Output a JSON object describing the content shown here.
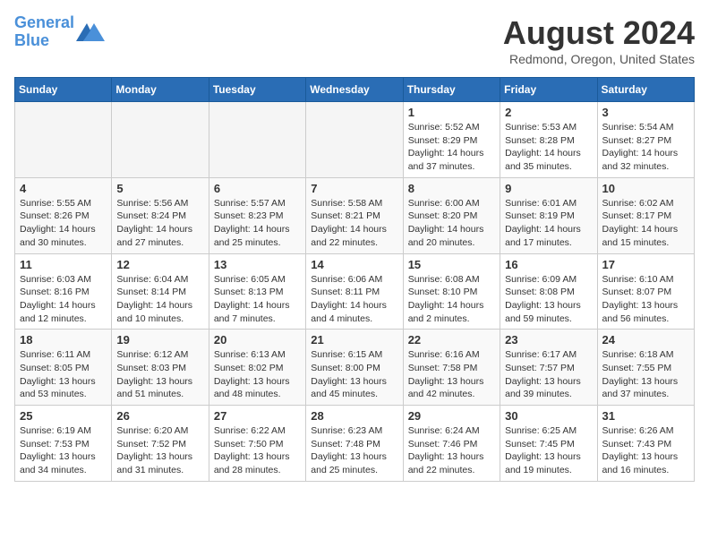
{
  "header": {
    "logo_line1": "General",
    "logo_line2": "Blue",
    "month": "August 2024",
    "location": "Redmond, Oregon, United States"
  },
  "weekdays": [
    "Sunday",
    "Monday",
    "Tuesday",
    "Wednesday",
    "Thursday",
    "Friday",
    "Saturday"
  ],
  "weeks": [
    [
      {
        "day": "",
        "info": ""
      },
      {
        "day": "",
        "info": ""
      },
      {
        "day": "",
        "info": ""
      },
      {
        "day": "",
        "info": ""
      },
      {
        "day": "1",
        "info": "Sunrise: 5:52 AM\nSunset: 8:29 PM\nDaylight: 14 hours\nand 37 minutes."
      },
      {
        "day": "2",
        "info": "Sunrise: 5:53 AM\nSunset: 8:28 PM\nDaylight: 14 hours\nand 35 minutes."
      },
      {
        "day": "3",
        "info": "Sunrise: 5:54 AM\nSunset: 8:27 PM\nDaylight: 14 hours\nand 32 minutes."
      }
    ],
    [
      {
        "day": "4",
        "info": "Sunrise: 5:55 AM\nSunset: 8:26 PM\nDaylight: 14 hours\nand 30 minutes."
      },
      {
        "day": "5",
        "info": "Sunrise: 5:56 AM\nSunset: 8:24 PM\nDaylight: 14 hours\nand 27 minutes."
      },
      {
        "day": "6",
        "info": "Sunrise: 5:57 AM\nSunset: 8:23 PM\nDaylight: 14 hours\nand 25 minutes."
      },
      {
        "day": "7",
        "info": "Sunrise: 5:58 AM\nSunset: 8:21 PM\nDaylight: 14 hours\nand 22 minutes."
      },
      {
        "day": "8",
        "info": "Sunrise: 6:00 AM\nSunset: 8:20 PM\nDaylight: 14 hours\nand 20 minutes."
      },
      {
        "day": "9",
        "info": "Sunrise: 6:01 AM\nSunset: 8:19 PM\nDaylight: 14 hours\nand 17 minutes."
      },
      {
        "day": "10",
        "info": "Sunrise: 6:02 AM\nSunset: 8:17 PM\nDaylight: 14 hours\nand 15 minutes."
      }
    ],
    [
      {
        "day": "11",
        "info": "Sunrise: 6:03 AM\nSunset: 8:16 PM\nDaylight: 14 hours\nand 12 minutes."
      },
      {
        "day": "12",
        "info": "Sunrise: 6:04 AM\nSunset: 8:14 PM\nDaylight: 14 hours\nand 10 minutes."
      },
      {
        "day": "13",
        "info": "Sunrise: 6:05 AM\nSunset: 8:13 PM\nDaylight: 14 hours\nand 7 minutes."
      },
      {
        "day": "14",
        "info": "Sunrise: 6:06 AM\nSunset: 8:11 PM\nDaylight: 14 hours\nand 4 minutes."
      },
      {
        "day": "15",
        "info": "Sunrise: 6:08 AM\nSunset: 8:10 PM\nDaylight: 14 hours\nand 2 minutes."
      },
      {
        "day": "16",
        "info": "Sunrise: 6:09 AM\nSunset: 8:08 PM\nDaylight: 13 hours\nand 59 minutes."
      },
      {
        "day": "17",
        "info": "Sunrise: 6:10 AM\nSunset: 8:07 PM\nDaylight: 13 hours\nand 56 minutes."
      }
    ],
    [
      {
        "day": "18",
        "info": "Sunrise: 6:11 AM\nSunset: 8:05 PM\nDaylight: 13 hours\nand 53 minutes."
      },
      {
        "day": "19",
        "info": "Sunrise: 6:12 AM\nSunset: 8:03 PM\nDaylight: 13 hours\nand 51 minutes."
      },
      {
        "day": "20",
        "info": "Sunrise: 6:13 AM\nSunset: 8:02 PM\nDaylight: 13 hours\nand 48 minutes."
      },
      {
        "day": "21",
        "info": "Sunrise: 6:15 AM\nSunset: 8:00 PM\nDaylight: 13 hours\nand 45 minutes."
      },
      {
        "day": "22",
        "info": "Sunrise: 6:16 AM\nSunset: 7:58 PM\nDaylight: 13 hours\nand 42 minutes."
      },
      {
        "day": "23",
        "info": "Sunrise: 6:17 AM\nSunset: 7:57 PM\nDaylight: 13 hours\nand 39 minutes."
      },
      {
        "day": "24",
        "info": "Sunrise: 6:18 AM\nSunset: 7:55 PM\nDaylight: 13 hours\nand 37 minutes."
      }
    ],
    [
      {
        "day": "25",
        "info": "Sunrise: 6:19 AM\nSunset: 7:53 PM\nDaylight: 13 hours\nand 34 minutes."
      },
      {
        "day": "26",
        "info": "Sunrise: 6:20 AM\nSunset: 7:52 PM\nDaylight: 13 hours\nand 31 minutes."
      },
      {
        "day": "27",
        "info": "Sunrise: 6:22 AM\nSunset: 7:50 PM\nDaylight: 13 hours\nand 28 minutes."
      },
      {
        "day": "28",
        "info": "Sunrise: 6:23 AM\nSunset: 7:48 PM\nDaylight: 13 hours\nand 25 minutes."
      },
      {
        "day": "29",
        "info": "Sunrise: 6:24 AM\nSunset: 7:46 PM\nDaylight: 13 hours\nand 22 minutes."
      },
      {
        "day": "30",
        "info": "Sunrise: 6:25 AM\nSunset: 7:45 PM\nDaylight: 13 hours\nand 19 minutes."
      },
      {
        "day": "31",
        "info": "Sunrise: 6:26 AM\nSunset: 7:43 PM\nDaylight: 13 hours\nand 16 minutes."
      }
    ]
  ]
}
